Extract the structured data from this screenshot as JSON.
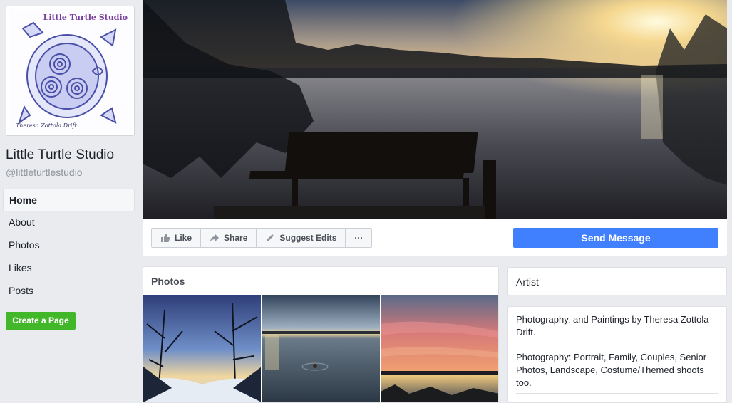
{
  "page": {
    "name": "Little Turtle Studio",
    "handle": "@littleturtlestudio",
    "logo_title": "Little Turtle Studio",
    "logo_signature": "Theresa Zottola Drift"
  },
  "nav": {
    "items": [
      {
        "label": "Home",
        "active": true
      },
      {
        "label": "About"
      },
      {
        "label": "Photos"
      },
      {
        "label": "Likes"
      },
      {
        "label": "Posts"
      }
    ],
    "create_page": "Create a Page"
  },
  "actions": {
    "like": "Like",
    "share": "Share",
    "suggest": "Suggest Edits",
    "more": "···",
    "send_message": "Send Message"
  },
  "photos": {
    "title": "Photos"
  },
  "category": "Artist",
  "about": {
    "line1": "Photography, and Paintings by Theresa Zottola Drift.",
    "line2": "Photography: Portrait, Family, Couples, Senior Photos, Landscape, Costume/Themed shoots too."
  },
  "colors": {
    "brand_blue": "#4080ff",
    "green": "#42b72a",
    "bg": "#e9ebee"
  }
}
